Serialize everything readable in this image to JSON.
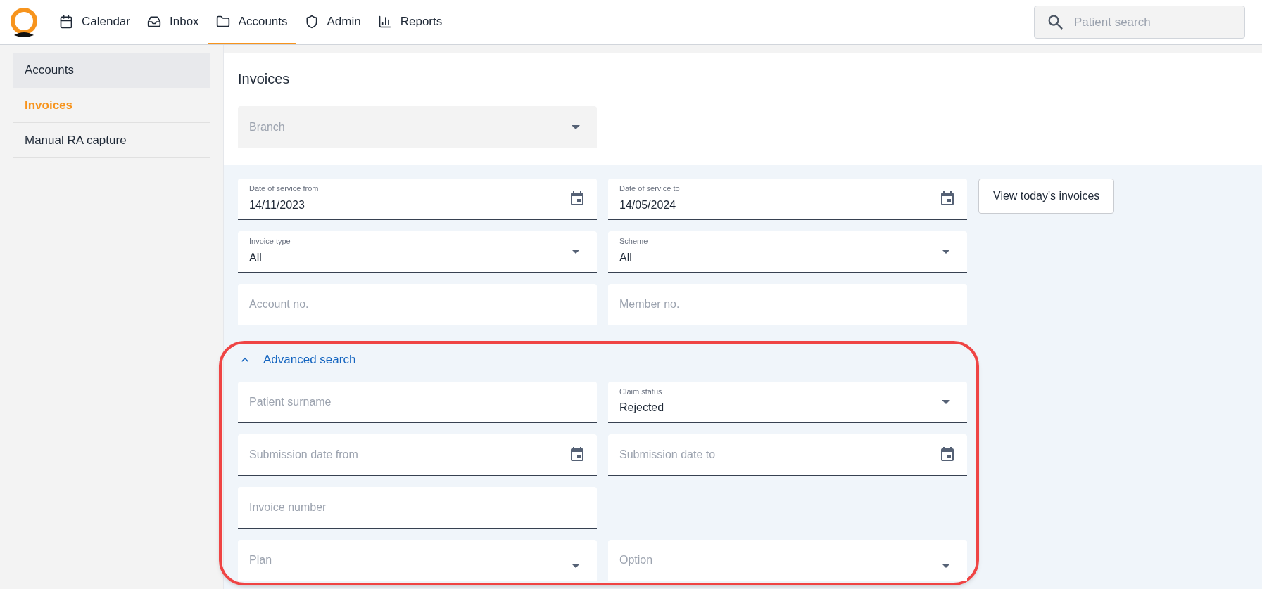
{
  "nav": {
    "tabs": [
      {
        "label": "Calendar",
        "kind": "calendar",
        "selected": false
      },
      {
        "label": "Inbox",
        "kind": "inbox",
        "selected": false
      },
      {
        "label": "Accounts",
        "kind": "folder",
        "selected": true
      },
      {
        "label": "Admin",
        "kind": "shield",
        "selected": false
      },
      {
        "label": "Reports",
        "kind": "chart",
        "selected": false
      }
    ],
    "search": {
      "placeholder": "Patient search"
    }
  },
  "sidebar": {
    "items": [
      {
        "label": "Accounts",
        "kind": "header",
        "selected": false
      },
      {
        "label": "Invoices",
        "kind": "link",
        "selected": true
      },
      {
        "label": "Manual RA capture",
        "kind": "link",
        "selected": false
      }
    ]
  },
  "page": {
    "title": "Invoices",
    "branch": {
      "placeholder": "Branch",
      "disabled": true
    }
  },
  "filters": {
    "rows": [
      [
        {
          "kind": "date",
          "label": "Date of service from",
          "value": "14/11/2023"
        },
        {
          "kind": "date",
          "label": "Date of service to",
          "value": "14/05/2024"
        },
        {
          "kind": "button",
          "label": "View today's invoices"
        }
      ],
      [
        {
          "kind": "select",
          "label": "Invoice type",
          "value": "All"
        },
        {
          "kind": "select",
          "label": "Scheme",
          "value": "All"
        }
      ],
      [
        {
          "kind": "text",
          "placeholder": "Account no."
        },
        {
          "kind": "text",
          "placeholder": "Member no."
        }
      ]
    ]
  },
  "advanced_search": {
    "label": "Advanced search",
    "expanded": true,
    "highlighted": true,
    "rows": [
      [
        {
          "kind": "text",
          "placeholder": "Patient surname"
        },
        {
          "kind": "select",
          "label": "Claim status",
          "value": "Rejected"
        }
      ],
      [
        {
          "kind": "date",
          "placeholder": "Submission date from"
        },
        {
          "kind": "date",
          "placeholder": "Submission date to"
        }
      ],
      [
        {
          "kind": "text",
          "placeholder": "Invoice number"
        }
      ],
      [
        {
          "kind": "select",
          "placeholder": "Plan"
        },
        {
          "kind": "select",
          "placeholder": "Option"
        }
      ]
    ]
  }
}
